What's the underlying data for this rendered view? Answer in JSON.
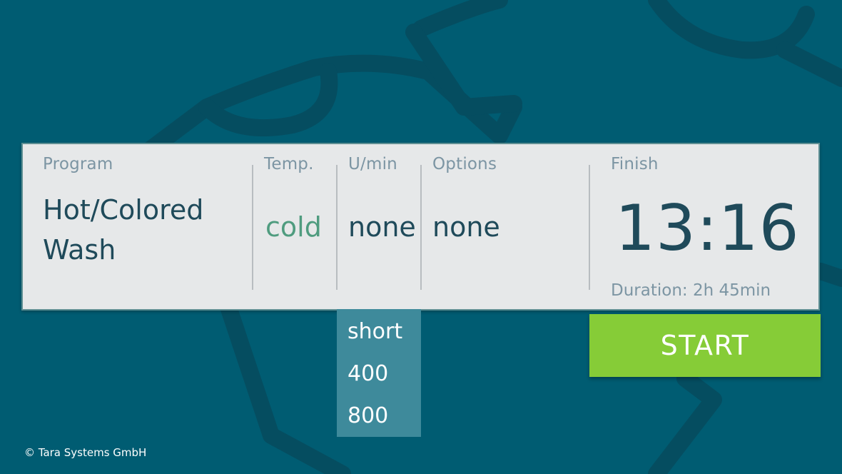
{
  "colors": {
    "background": "#005c72",
    "panel": "#e6e8e9",
    "label": "#7c95a3",
    "value": "#1f4a5a",
    "temp_value": "#4f9c7f",
    "dropdown": "#3e8a9b",
    "start": "#86cc37"
  },
  "program": {
    "label": "Program",
    "value_line1": "Hot/Colored",
    "value_line2": "Wash"
  },
  "temperature": {
    "label": "Temp.",
    "value": "cold"
  },
  "spin": {
    "label": "U/min",
    "value": "none",
    "options": [
      "short",
      "400",
      "800"
    ]
  },
  "options": {
    "label": "Options",
    "value": "none"
  },
  "finish": {
    "label": "Finish",
    "time": "13:16",
    "duration": "Duration: 2h 45min"
  },
  "start_button": {
    "label": "START"
  },
  "footer": {
    "copyright": "© Tara Systems GmbH"
  },
  "background_icon": "laundry-shirt-icon"
}
